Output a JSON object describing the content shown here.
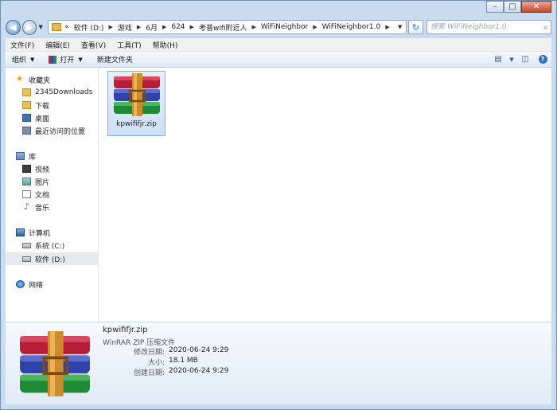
{
  "window": {
    "minimize": "–",
    "maximize": "□",
    "close": "✕"
  },
  "address": {
    "overflow": "«",
    "crumbs": [
      "软件 (D:)",
      "游戏",
      "6月",
      "624",
      "考普wifi附近人",
      "WiFiNeighbor",
      "WiFiNeighbor1.0"
    ]
  },
  "search": {
    "placeholder": "搜索 WiFiNeighbor1.0"
  },
  "menu": [
    "文件(F)",
    "编辑(E)",
    "查看(V)",
    "工具(T)",
    "帮助(H)"
  ],
  "toolbar": {
    "organize": "组织",
    "open": "打开",
    "new_folder": "新建文件夹"
  },
  "nav": {
    "favorites": "收藏夹",
    "downloads_2345": "2345Downloads",
    "downloads": "下载",
    "desktop": "桌面",
    "recent": "最近访问的位置",
    "libraries": "库",
    "videos": "视频",
    "pictures": "图片",
    "documents": "文档",
    "music": "音乐",
    "computer": "计算机",
    "drive_c": "系统 (C:)",
    "drive_d": "软件 (D:)",
    "network": "网络"
  },
  "files": [
    {
      "name": "kpwififjr.zip"
    }
  ],
  "details": {
    "name": "kpwififjr.zip",
    "type": "WinRAR ZIP 压缩文件",
    "modified_label": "修改日期:",
    "modified": "2020-06-24 9:29",
    "size_label": "大小:",
    "size": "18.1 MB",
    "created_label": "创建日期:",
    "created": "2020-06-24 9:29"
  }
}
